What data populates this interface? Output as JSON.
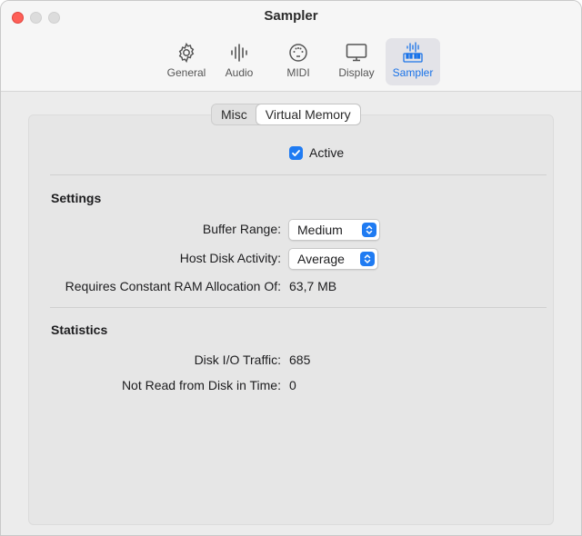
{
  "window": {
    "title": "Sampler"
  },
  "toolbar": {
    "items": [
      {
        "label": "General",
        "icon": "gear-icon"
      },
      {
        "label": "Audio",
        "icon": "waveform-icon"
      },
      {
        "label": "MIDI",
        "icon": "midi-port-icon"
      },
      {
        "label": "Display",
        "icon": "monitor-icon"
      },
      {
        "label": "Sampler",
        "icon": "sampler-keyboard-icon",
        "selected": true
      }
    ]
  },
  "tabs": [
    {
      "label": "Misc",
      "active": false
    },
    {
      "label": "Virtual Memory",
      "active": true
    }
  ],
  "active_checkbox": {
    "label": "Active",
    "checked": true
  },
  "settings": {
    "title": "Settings",
    "buffer_range": {
      "label": "Buffer Range:",
      "value": "Medium"
    },
    "host_disk_activity": {
      "label": "Host Disk Activity:",
      "value": "Average"
    },
    "ram_allocation": {
      "label": "Requires Constant RAM Allocation Of:",
      "value": "63,7 MB"
    }
  },
  "statistics": {
    "title": "Statistics",
    "disk_io": {
      "label": "Disk I/O Traffic:",
      "value": "685"
    },
    "not_read": {
      "label": "Not Read from Disk in Time:",
      "value": "0"
    }
  },
  "colors": {
    "accent": "#1f7bf2",
    "close": "#fe5f57"
  }
}
